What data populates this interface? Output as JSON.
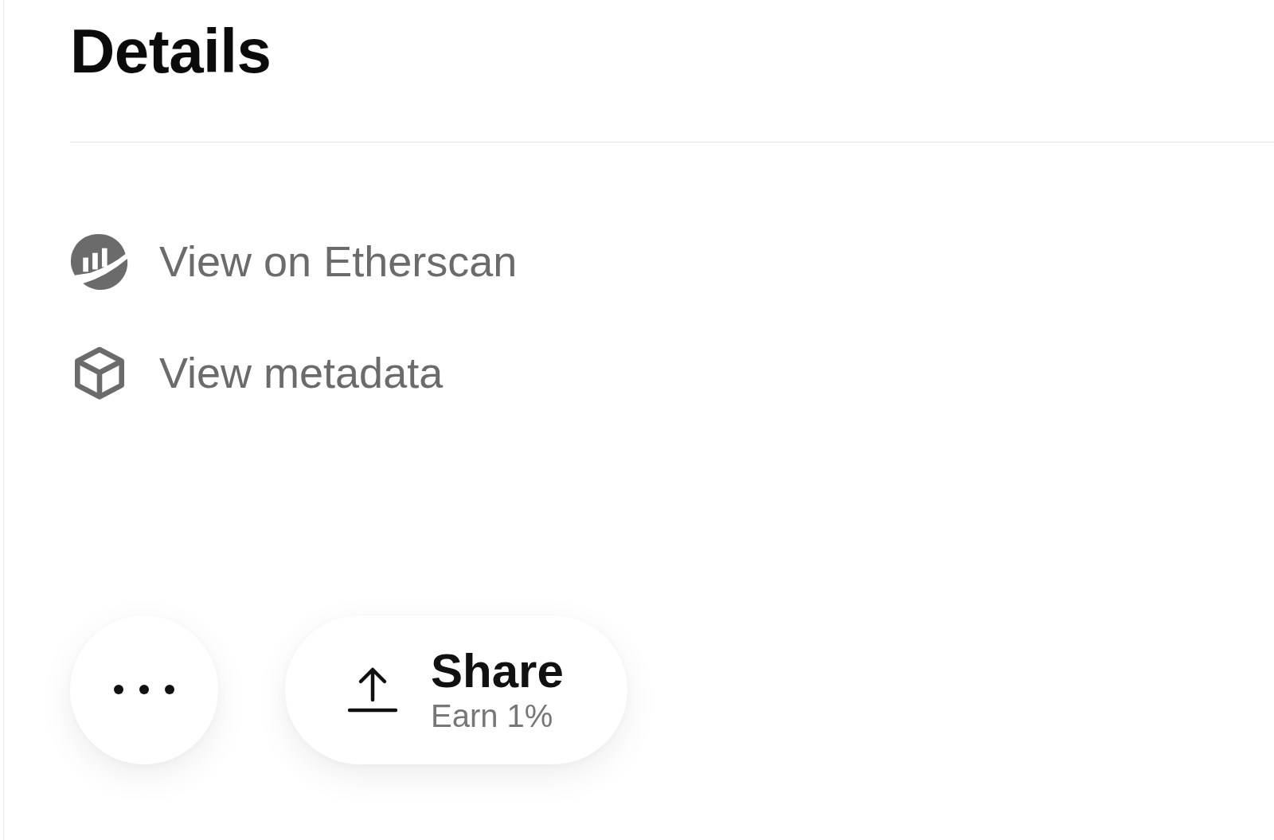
{
  "heading": "Details",
  "links": [
    {
      "kind": "etherscan",
      "label": "View on Etherscan"
    },
    {
      "kind": "metadata",
      "label": "View metadata"
    }
  ],
  "actions": [
    {
      "kind": "more"
    },
    {
      "kind": "share",
      "label": "Share",
      "sublabel": "Earn 1%"
    }
  ]
}
